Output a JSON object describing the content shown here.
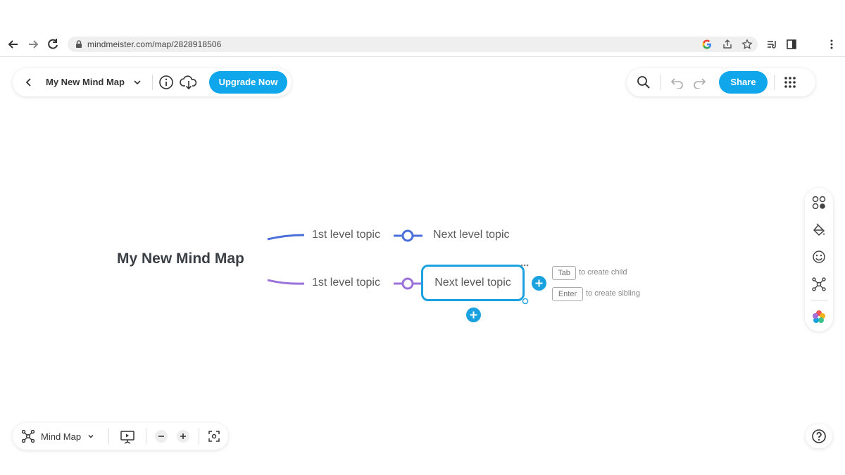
{
  "browser": {
    "url": "mindmeister.com/map/2828918506"
  },
  "header": {
    "map_title": "My New Mind Map",
    "upgrade_label": "Upgrade Now",
    "share_label": "Share"
  },
  "mind_map": {
    "root": "My New Mind Map",
    "branches": [
      {
        "topic": "1st level topic",
        "child": "Next level topic",
        "color": "#4a6fd8"
      },
      {
        "topic": "1st level topic",
        "child": "Next level topic",
        "color": "#9b72d9"
      }
    ],
    "hints": [
      {
        "key": "Tab",
        "text": "to create child"
      },
      {
        "key": "Enter",
        "text": "to create sibling"
      }
    ]
  },
  "bottom_toolbar": {
    "view_mode": "Mind Map"
  },
  "colors": {
    "accent": "#0fa6ec",
    "selection": "#1aa2e0"
  }
}
